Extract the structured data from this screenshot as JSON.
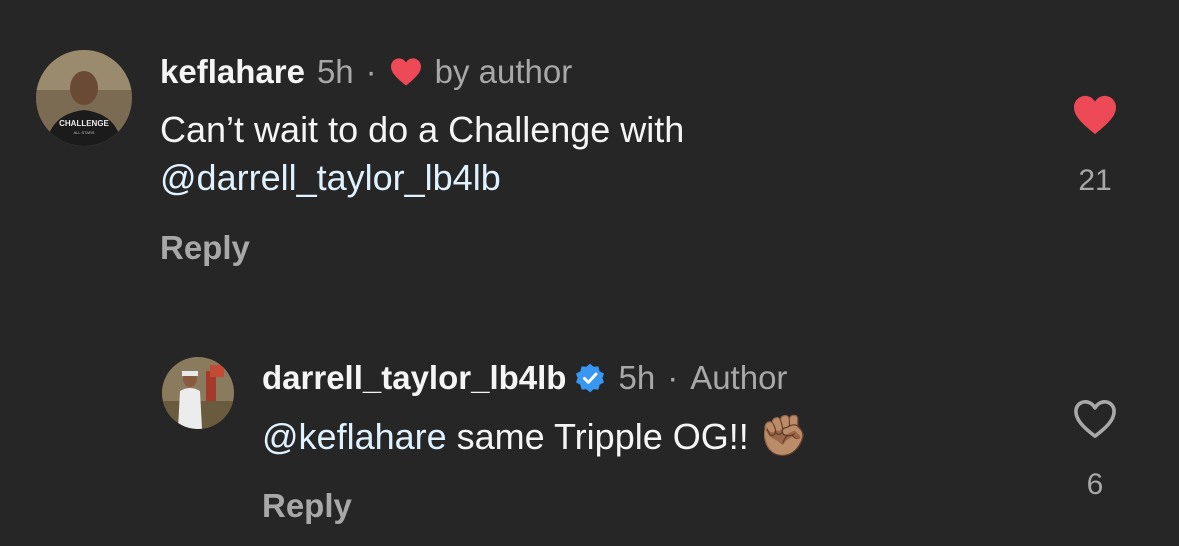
{
  "comments": [
    {
      "username": "keflahare",
      "time": "5h",
      "separator": "·",
      "badge": "by author",
      "text_line1": "Can’t wait to do a Challenge with",
      "mention": "@darrell_taylor_lb4lb",
      "reply_label": "Reply",
      "like_count": "21",
      "liked": true,
      "avatar_shirt_text": "CHALLENGE",
      "avatar_shirt_subtext": "ALL STARS"
    },
    {
      "username": "darrell_taylor_lb4lb",
      "verified": true,
      "time": "5h",
      "separator": "·",
      "badge": "Author",
      "mention": "@keflahare",
      "text": " same Tripple OG!! ",
      "emoji": "✊🏽",
      "reply_label": "Reply",
      "like_count": "6",
      "liked": false
    }
  ],
  "colors": {
    "background": "#262626",
    "text": "#f5f5f5",
    "muted": "#a8a8a8",
    "like_red": "#ed4956",
    "verified_blue": "#3897f0"
  },
  "icons": [
    "heart-filled-icon",
    "heart-outline-icon",
    "verified-badge-icon",
    "raised-fist-emoji"
  ]
}
